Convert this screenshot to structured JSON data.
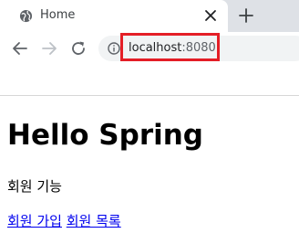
{
  "browser": {
    "tab": {
      "title": "Home",
      "icon": "globe-icon",
      "close_icon": "close-icon"
    },
    "new_tab_icon": "plus-icon",
    "toolbar": {
      "back_icon": "back-arrow-icon",
      "forward_icon": "forward-arrow-icon",
      "reload_icon": "reload-icon",
      "info_icon": "info-icon"
    },
    "address_bar": {
      "host": "localhost",
      "port": ":8080"
    },
    "highlight_color": "#e41e26"
  },
  "page": {
    "heading": "Hello Spring",
    "subtitle": "회원 기능",
    "links": [
      {
        "label": "회원 가입"
      },
      {
        "label": "회원 목록"
      }
    ],
    "link_color": "#0000ee"
  }
}
